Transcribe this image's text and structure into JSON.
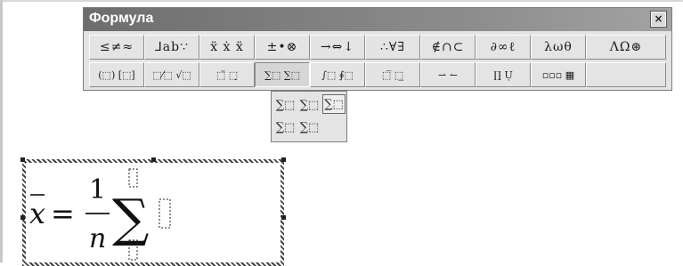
{
  "window": {
    "title": "Формула",
    "close_label": "×"
  },
  "toolbar": {
    "row1": [
      {
        "name": "relations-group-button",
        "label": "≤≠≈"
      },
      {
        "name": "spaces-ellipses-group-button",
        "label": "⅃ab∵"
      },
      {
        "name": "embellishments-group-button",
        "label": "ẍ ẋ ẍ"
      },
      {
        "name": "operators-group-button",
        "label": "±•⊗"
      },
      {
        "name": "arrows-group-button",
        "label": "→⇔↓"
      },
      {
        "name": "logic-group-button",
        "label": "∴∀∃"
      },
      {
        "name": "set-theory-group-button",
        "label": "∉∩⊂"
      },
      {
        "name": "misc-symbols-group-button",
        "label": "∂∞ℓ"
      },
      {
        "name": "greek-lowercase-button",
        "label": "λωθ"
      },
      {
        "name": "greek-uppercase-button",
        "label": "ΛΩ⊛"
      }
    ],
    "row2": [
      {
        "name": "fences-templates-button",
        "label": "(⬚) [⬚]"
      },
      {
        "name": "fraction-radical-templates-button",
        "label": "⬚⁄⬚ √⬚"
      },
      {
        "name": "subscript-superscript-templates-button",
        "label": "⬚̈ ⬚̣"
      },
      {
        "name": "summation-templates-button",
        "label": "∑⬚ ∑⬚"
      },
      {
        "name": "integral-templates-button",
        "label": "∫⬚ ∮⬚"
      },
      {
        "name": "underbar-overbar-templates-button",
        "label": "⬚̅ ⬚̲"
      },
      {
        "name": "labeled-arrow-templates-button",
        "label": "⇀ ↼"
      },
      {
        "name": "products-set-templates-button",
        "label": "∏̣ Ụ"
      },
      {
        "name": "matrix-templates-button",
        "label": "▫▫▫ ▦"
      },
      {
        "name": "empty-slot-button",
        "label": ""
      }
    ]
  },
  "summation_menu": {
    "items": [
      {
        "name": "sum-no-limits-item",
        "label": "∑⬚"
      },
      {
        "name": "sum-lower-limit-item",
        "label": "∑⬚"
      },
      {
        "name": "sum-both-limits-item",
        "label": "∑⬚"
      },
      {
        "name": "sum-lower-limit-under-item",
        "label": "∑⬚"
      },
      {
        "name": "sum-both-limits-under-item",
        "label": "∑⬚"
      }
    ]
  },
  "formula": {
    "variable": "x",
    "equals": "=",
    "numerator": "1",
    "denominator": "n",
    "operator": "∑"
  }
}
